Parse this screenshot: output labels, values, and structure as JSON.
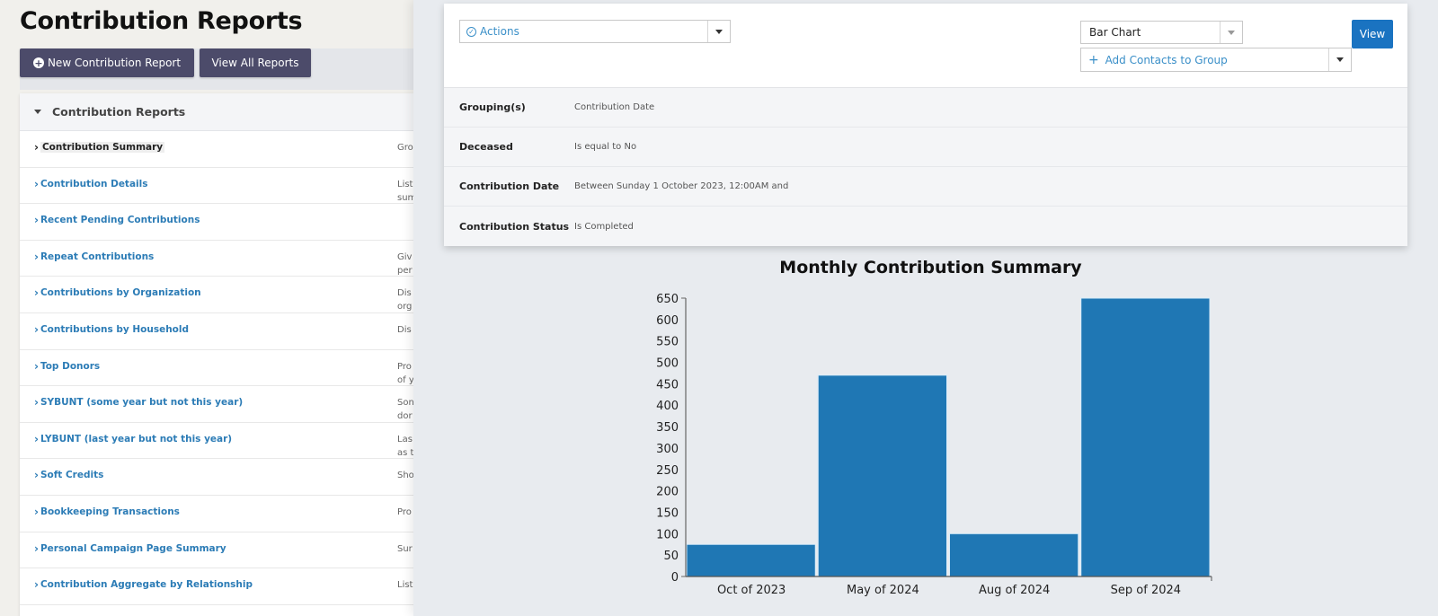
{
  "page": {
    "title": "Contribution Reports",
    "buttons": {
      "new_report": "New Contribution Report",
      "view_all": "View All Reports"
    }
  },
  "reports_panel": {
    "header": "Contribution Reports",
    "items": [
      {
        "label": "Contribution Summary",
        "desc": [
          "Gro"
        ],
        "active": true
      },
      {
        "label": "Contribution Details",
        "desc": [
          "List",
          "sum"
        ]
      },
      {
        "label": "Recent Pending Contributions",
        "desc": []
      },
      {
        "label": "Repeat Contributions",
        "desc": [
          "Giv",
          "per"
        ]
      },
      {
        "label": "Contributions by Organization",
        "desc": [
          "Dis",
          "org"
        ]
      },
      {
        "label": "Contributions by Household",
        "desc": [
          "Dis"
        ]
      },
      {
        "label": "Top Donors",
        "desc": [
          "Pro",
          "of y"
        ]
      },
      {
        "label": "SYBUNT (some year but not this year)",
        "desc": [
          "Son",
          "dor"
        ]
      },
      {
        "label": "LYBUNT (last year but not this year)",
        "desc": [
          "Las",
          "as t"
        ]
      },
      {
        "label": "Soft Credits",
        "desc": [
          "Sho"
        ]
      },
      {
        "label": "Bookkeeping Transactions",
        "desc": [
          "Pro"
        ]
      },
      {
        "label": "Personal Campaign Page Summary",
        "desc": [
          "Sur"
        ]
      },
      {
        "label": "Contribution Aggregate by Relationship",
        "desc": [
          "List"
        ]
      }
    ]
  },
  "toolbar": {
    "actions_label": "Actions",
    "chart_type_selected": "Bar Chart",
    "add_to_group_label": "Add Contacts to Group",
    "view_button": "View"
  },
  "criteria": [
    {
      "label": "Grouping(s)",
      "value": "Contribution Date"
    },
    {
      "label": "Deceased",
      "value": "Is equal to No"
    },
    {
      "label": "Contribution Date",
      "value": "Between Sunday 1 October 2023, 12:00AM and"
    },
    {
      "label": "Contribution Status",
      "value": "Is Completed"
    }
  ],
  "colors": {
    "bar": "#1f77b4",
    "primary_button": "#1a73c1",
    "dark_button": "#4c4b6a",
    "link": "#2c7cb6"
  },
  "chart_data": {
    "type": "bar",
    "title": "Monthly Contribution Summary",
    "categories": [
      "Oct of 2023",
      "May of 2024",
      "Aug of 2024",
      "Sep of 2024"
    ],
    "values": [
      75,
      470,
      100,
      650
    ],
    "xlabel": "",
    "ylabel": "",
    "ylim": [
      0,
      650
    ],
    "yticks": [
      0,
      50,
      100,
      150,
      200,
      250,
      300,
      350,
      400,
      450,
      500,
      550,
      600,
      650
    ],
    "grid": false,
    "legend": "none"
  }
}
